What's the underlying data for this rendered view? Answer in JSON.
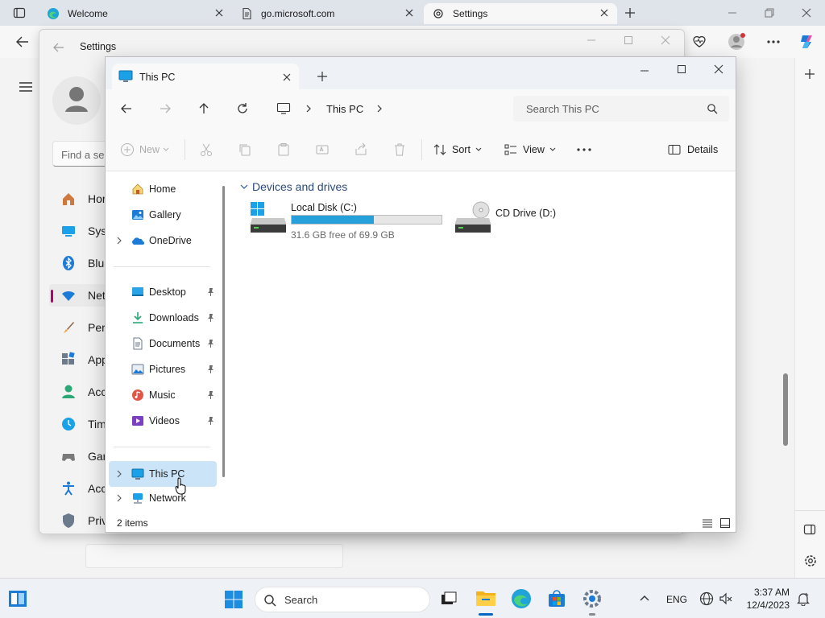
{
  "browser": {
    "tabs": [
      {
        "label": "Welcome"
      },
      {
        "label": "go.microsoft.com"
      },
      {
        "label": "Settings"
      }
    ]
  },
  "settings": {
    "title": "Settings",
    "search_placeholder": "Find a se",
    "nav": [
      "Hor",
      "Syst",
      "Blue",
      "Net",
      "Pers",
      "App",
      "Acc",
      "Tim",
      "Gar",
      "Acc",
      "Priv"
    ]
  },
  "explorer": {
    "tab_title": "This PC",
    "address": "This PC",
    "search_placeholder": "Search This PC",
    "commands": {
      "new": "New",
      "sort": "Sort",
      "view": "View",
      "details": "Details"
    },
    "nav": {
      "home": "Home",
      "gallery": "Gallery",
      "onedrive": "OneDrive",
      "desktop": "Desktop",
      "downloads": "Downloads",
      "documents": "Documents",
      "pictures": "Pictures",
      "music": "Music",
      "videos": "Videos",
      "this_pc": "This PC",
      "network": "Network"
    },
    "section_header": "Devices and drives",
    "drives": [
      {
        "name": "Local Disk (C:)",
        "free_text": "31.6 GB free of 69.9 GB",
        "used_fraction": 0.548
      },
      {
        "name": "CD Drive (D:)"
      }
    ],
    "status": "2 items"
  },
  "taskbar": {
    "search_label": "Search",
    "lang": "ENG",
    "time": "3:37 AM",
    "date": "12/4/2023"
  },
  "colors": {
    "accent": "#0067c0",
    "drive_bar": "#26a0da",
    "selection": "#cce4f7"
  }
}
